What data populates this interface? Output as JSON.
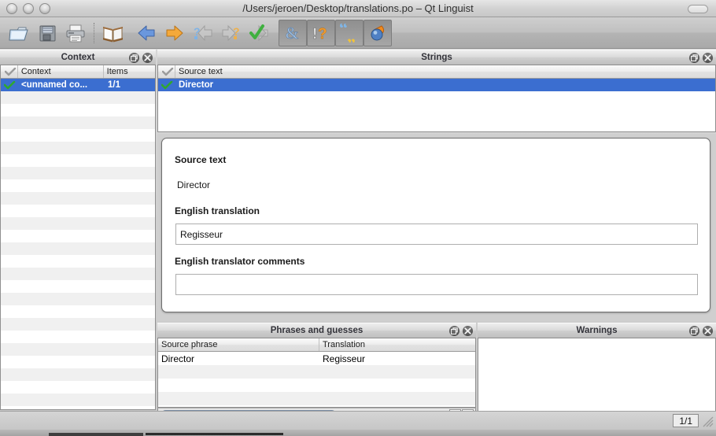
{
  "window": {
    "title": "/Users/jeroen/Desktop/translations.po – Qt Linguist",
    "traffic_lights": [
      "close",
      "minimize",
      "zoom"
    ]
  },
  "toolbar": {
    "buttons": [
      {
        "name": "open-file",
        "icon": "open-folder-icon",
        "toggled": false
      },
      {
        "name": "save-file",
        "icon": "floppy-disk-icon",
        "toggled": false
      },
      {
        "name": "print",
        "icon": "printer-icon",
        "toggled": false
      },
      {
        "name": "open-phrase-book",
        "icon": "book-icon",
        "toggled": false
      },
      {
        "name": "prev",
        "icon": "left-arrow-icon",
        "toggled": false
      },
      {
        "name": "next",
        "icon": "right-arrow-icon",
        "toggled": false
      },
      {
        "name": "prev-unfinished",
        "icon": "question-left-arrow-icon",
        "toggled": false
      },
      {
        "name": "next-unfinished",
        "icon": "question-right-arrow-icon",
        "toggled": false
      },
      {
        "name": "done-and-next",
        "icon": "green-check-arrow-icon",
        "toggled": false
      },
      {
        "name": "accelerator-validation",
        "icon": "ampersand-icon",
        "toggled": true
      },
      {
        "name": "ending-punctuation-validation",
        "icon": "exclamation-question-icon",
        "toggled": true
      },
      {
        "name": "phrase-match-validation",
        "icon": "quotes-icon",
        "toggled": true
      },
      {
        "name": "place-marker-validation",
        "icon": "drop-marker-icon",
        "toggled": true
      }
    ]
  },
  "context_panel": {
    "title": "Context",
    "columns": [
      "Context",
      "Items"
    ],
    "rows": [
      {
        "checked": true,
        "context": "<unnamed co...",
        "items": "1/1",
        "selected": true
      }
    ]
  },
  "strings_panel": {
    "title": "Strings",
    "columns": [
      "Source text"
    ],
    "rows": [
      {
        "checked": true,
        "source_text": "Director",
        "selected": true
      }
    ]
  },
  "editor": {
    "source_label": "Source text",
    "source_value": "Director",
    "translation_label": "English translation",
    "translation_value": "Regisseur",
    "translation_placeholder": "",
    "comments_label": "English translator comments",
    "comments_value": "",
    "comments_placeholder": ""
  },
  "phrases_panel": {
    "title": "Phrases and guesses",
    "columns": [
      "Source phrase",
      "Translation"
    ],
    "rows": [
      {
        "source_phrase": "Director",
        "translation": "Regisseur"
      }
    ]
  },
  "warnings_panel": {
    "title": "Warnings",
    "rows": []
  },
  "statusbar": {
    "count": "1/1"
  },
  "dock_buttons": {
    "float": "float-icon",
    "close": "close-icon"
  },
  "colors": {
    "selection": "#3b6ed0",
    "alt_row": "#f0f0f0",
    "check_green": "#2fa72f",
    "arrow_blue": "#4f7fd4",
    "arrow_orange": "#f0971f"
  }
}
